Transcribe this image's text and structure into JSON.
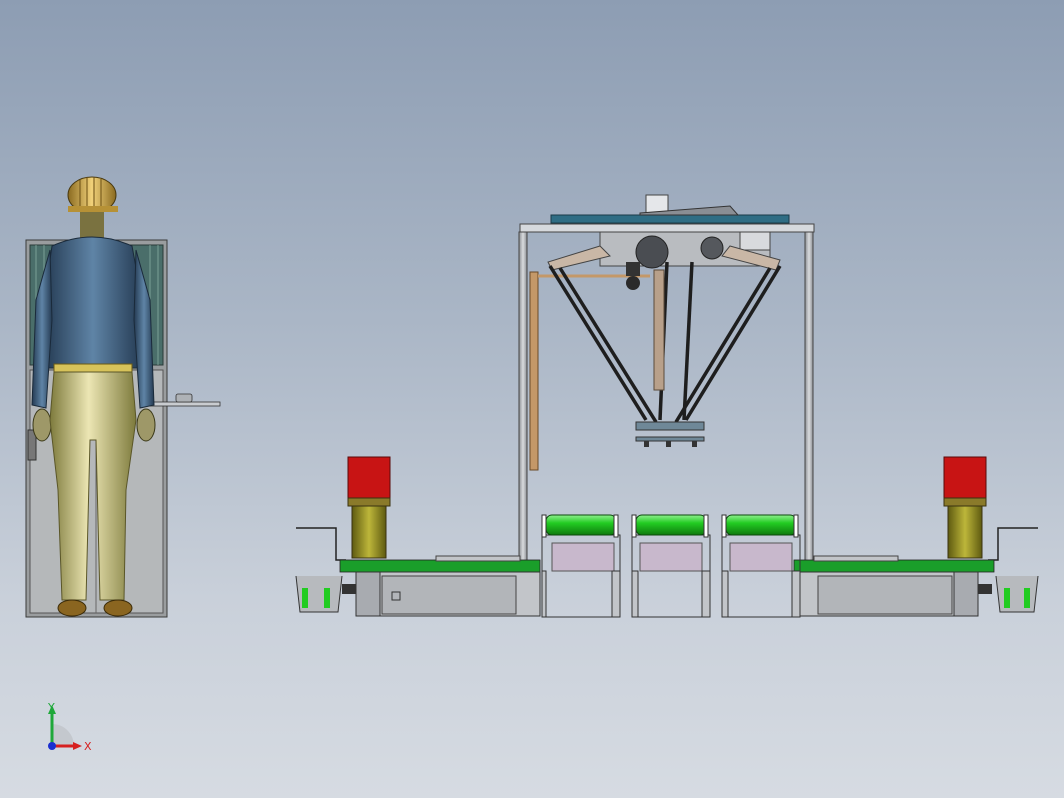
{
  "viewport": {
    "background_top": "#8d9db3",
    "background_bottom": "#d6dbe2"
  },
  "triad": {
    "x_label": "X",
    "y_label": "Y",
    "x_color": "#d62020",
    "y_color": "#1fa83a",
    "z_color": "#1a2fd0"
  },
  "colors": {
    "robot_plate": "#2f6d84",
    "conveyor_belt": "#1a9e2a",
    "roller_green": "#22cc22",
    "motor_red": "#c81414",
    "gearbox_olive": "#8f8a1e",
    "bin_pink": "#c8b8cc",
    "worker_jacket": "#3b5a78",
    "worker_pants": "#c8c27a",
    "helmet": "#d8b455"
  },
  "icons": {
    "triad": "coordinate-triad-icon"
  }
}
